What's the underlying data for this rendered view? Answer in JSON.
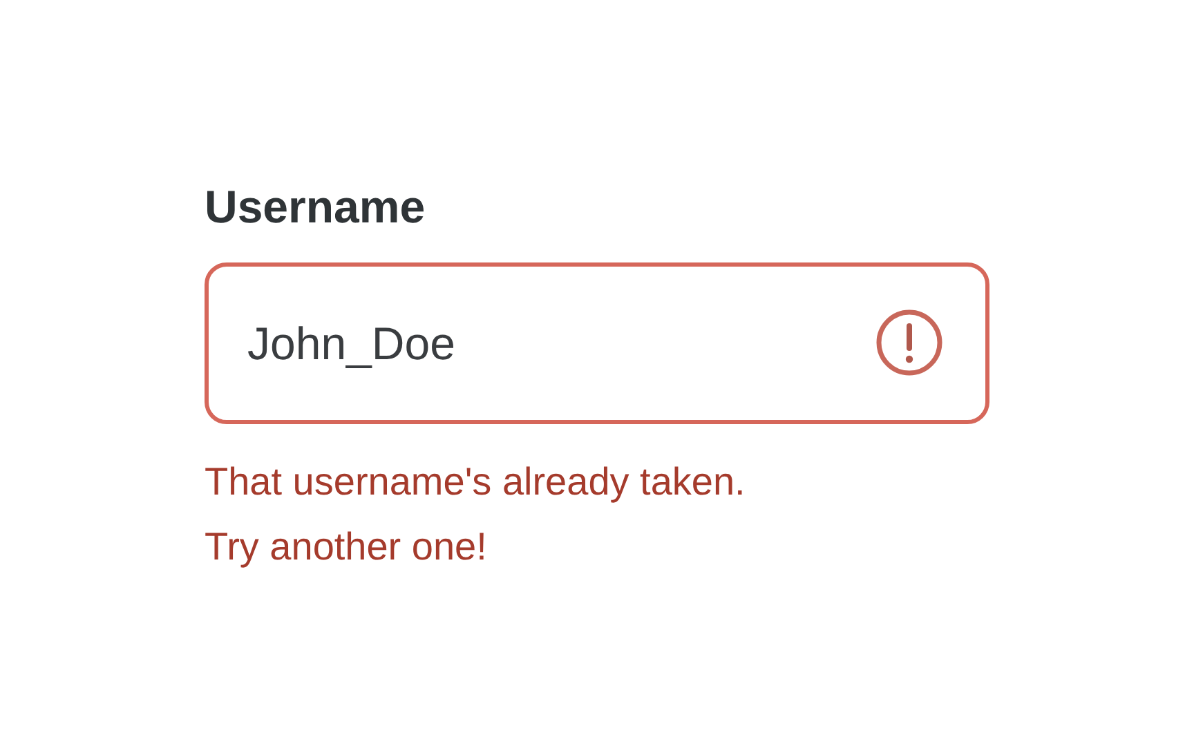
{
  "field": {
    "label": "Username",
    "value": "John_Doe",
    "error": true
  },
  "error_lines": [
    "That username's already taken.",
    "Try another one!"
  ]
}
